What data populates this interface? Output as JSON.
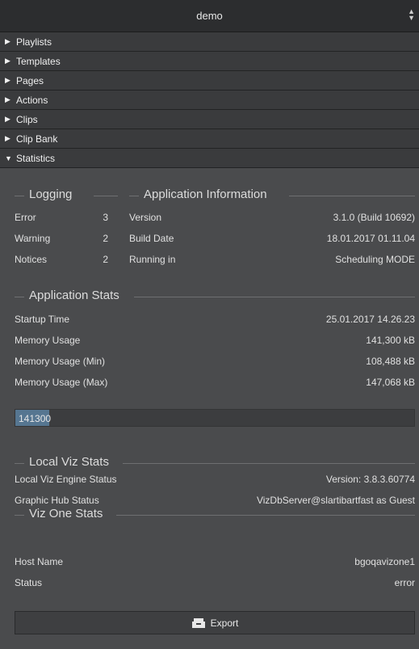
{
  "selector": {
    "value": "demo"
  },
  "nav": {
    "items": [
      {
        "label": "Playlists",
        "expanded": false
      },
      {
        "label": "Templates",
        "expanded": false
      },
      {
        "label": "Pages",
        "expanded": false
      },
      {
        "label": "Actions",
        "expanded": false
      },
      {
        "label": "Clips",
        "expanded": false
      },
      {
        "label": "Clip Bank",
        "expanded": false
      },
      {
        "label": "Statistics",
        "expanded": true
      }
    ]
  },
  "logging": {
    "title": "Logging",
    "rows": [
      {
        "label": "Error",
        "value": "3"
      },
      {
        "label": "Warning",
        "value": "2"
      },
      {
        "label": "Notices",
        "value": "2"
      }
    ]
  },
  "app_info": {
    "title": "Application Information",
    "rows": [
      {
        "label": "Version",
        "value": "3.1.0 (Build 10692)"
      },
      {
        "label": "Build Date",
        "value": "18.01.2017 01.11.04"
      },
      {
        "label": "Running in",
        "value": "Scheduling MODE"
      }
    ]
  },
  "app_stats": {
    "title": "Application Stats",
    "rows": [
      {
        "label": "Startup Time",
        "value": "25.01.2017 14.26.23"
      },
      {
        "label": "Memory Usage",
        "value": "141,300 kB"
      },
      {
        "label": "Memory Usage (Min)",
        "value": "108,488 kB"
      },
      {
        "label": "Memory Usage (Max)",
        "value": "147,068 kB"
      }
    ],
    "bar": {
      "text": "141300",
      "fill_fraction": 0.085
    }
  },
  "local_viz": {
    "title": "Local Viz Stats",
    "rows": [
      {
        "label": "Local Viz Engine Status",
        "value": "Version: 3.8.3.60774"
      },
      {
        "label": "Graphic Hub Status",
        "value": "VizDbServer@slartibartfast as Guest"
      }
    ]
  },
  "viz_one": {
    "title": "Viz One Stats",
    "rows": [
      {
        "label": "Host Name",
        "value": "bgoqavizone1"
      },
      {
        "label": "Status",
        "value": "error"
      }
    ]
  },
  "export": {
    "label": "Export",
    "icon": "export-icon"
  }
}
